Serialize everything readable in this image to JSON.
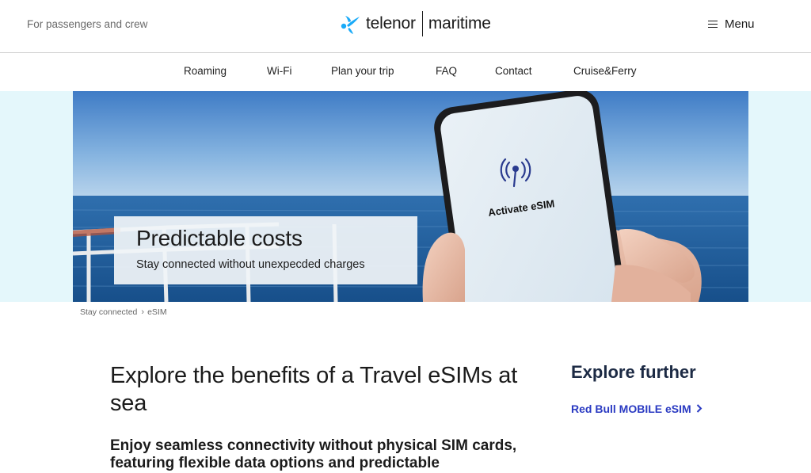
{
  "header": {
    "tagline": "For passengers and crew",
    "logo": {
      "brand": "telenor",
      "sub": "maritime",
      "icon": "telenor-propeller-icon",
      "icon_color": "#19aaf8"
    },
    "menu_label": "Menu",
    "menu_icon": "hamburger-icon"
  },
  "nav": {
    "items": [
      {
        "label": "Roaming"
      },
      {
        "label": "Wi-Fi"
      },
      {
        "label": "Plan your trip"
      },
      {
        "label": "FAQ"
      },
      {
        "label": "Contact"
      },
      {
        "label": "Cruise&Ferry"
      }
    ]
  },
  "hero": {
    "title": "Predictable costs",
    "subtitle": "Stay connected without unexpecded charges",
    "phone_text": "Activate eSIM",
    "phone_icon": "antenna-signal-icon"
  },
  "breadcrumb": {
    "items": [
      {
        "label": "Stay connected"
      },
      {
        "label": "eSIM"
      }
    ],
    "separator_icon": "chevron-right-icon"
  },
  "main": {
    "title": "Explore the benefits of a Travel eSIMs at sea",
    "lead": "Enjoy seamless connectivity without physical SIM cards, featuring flexible data options and predictable"
  },
  "aside": {
    "title": "Explore further",
    "link_label": "Red Bull MOBILE eSIM",
    "link_icon": "chevron-right-icon",
    "link_color": "#2a3ac2"
  },
  "colors": {
    "hero_band": "#e4f7fb",
    "sky_top": "#3f7cc6",
    "sea": "#2a6aa8",
    "text": "#1b1b1b"
  }
}
